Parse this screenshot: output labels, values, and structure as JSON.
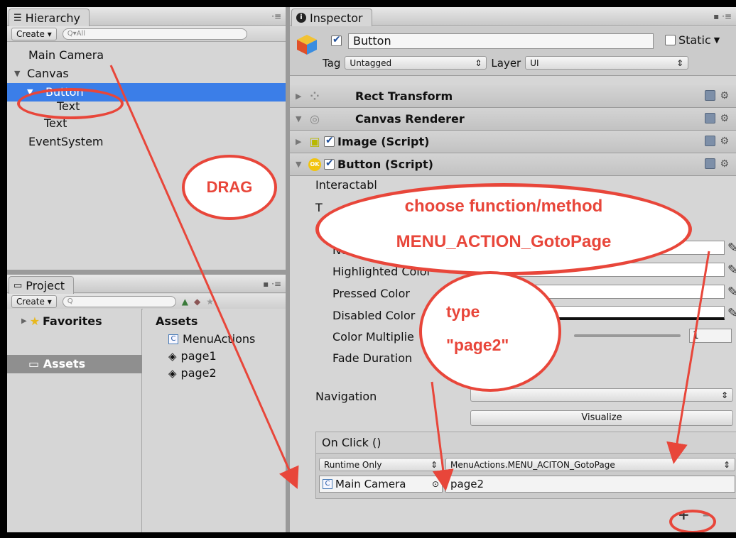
{
  "hierarchy": {
    "tab_label": "Hierarchy",
    "create_label": "Create",
    "search_placeholder": "Q▾All",
    "items": [
      {
        "label": "Main Camera"
      },
      {
        "label": "Canvas"
      },
      {
        "label": "Button"
      },
      {
        "label": "Text"
      },
      {
        "label": "Text"
      },
      {
        "label": "EventSystem"
      }
    ]
  },
  "project": {
    "tab_label": "Project",
    "create_label": "Create",
    "search_placeholder": "Q",
    "favorites_label": "Favorites",
    "assets_folder_label": "Assets",
    "assets_header": "Assets",
    "files": [
      {
        "label": "MenuActions",
        "icon": "script-icon"
      },
      {
        "label": "page1",
        "icon": "unity-scene-icon"
      },
      {
        "label": "page2",
        "icon": "unity-scene-icon"
      }
    ]
  },
  "inspector": {
    "tab_label": "Inspector",
    "object_name": "Button",
    "static_label": "Static",
    "tag_label": "Tag",
    "tag_value": "Untagged",
    "layer_label": "Layer",
    "layer_value": "UI",
    "components": [
      {
        "label": "Rect Transform"
      },
      {
        "label": "Canvas Renderer"
      },
      {
        "label": "Image (Script)"
      },
      {
        "label": "Button (Script)"
      }
    ],
    "props": {
      "interactable": "Interactabl",
      "transition": "T",
      "normal_color": "No",
      "highlighted": "Highlighted Color",
      "pressed": "Pressed Color",
      "disabled": "Disabled Color",
      "multiplier": "Color Multiplie",
      "multiplier_value": "1",
      "fade": "Fade Duration",
      "navigation": "Navigation",
      "visualize": "Visualize"
    },
    "onclick": {
      "header": "On Click ()",
      "runtime": "Runtime Only",
      "function": "MenuActions.MENU_ACITON_GotoPage",
      "object": "Main Camera",
      "argument": "page2",
      "plus": "+",
      "minus": "–"
    }
  },
  "annotations": {
    "drag": "DRAG",
    "choose_line1": "choose function/method",
    "choose_line2": "MENU_ACTION_GotoPage",
    "type_line1": "type",
    "type_line2": "\"page2\""
  },
  "colors": {
    "annotation": "#e8463a",
    "selection": "#3b7ee8"
  }
}
